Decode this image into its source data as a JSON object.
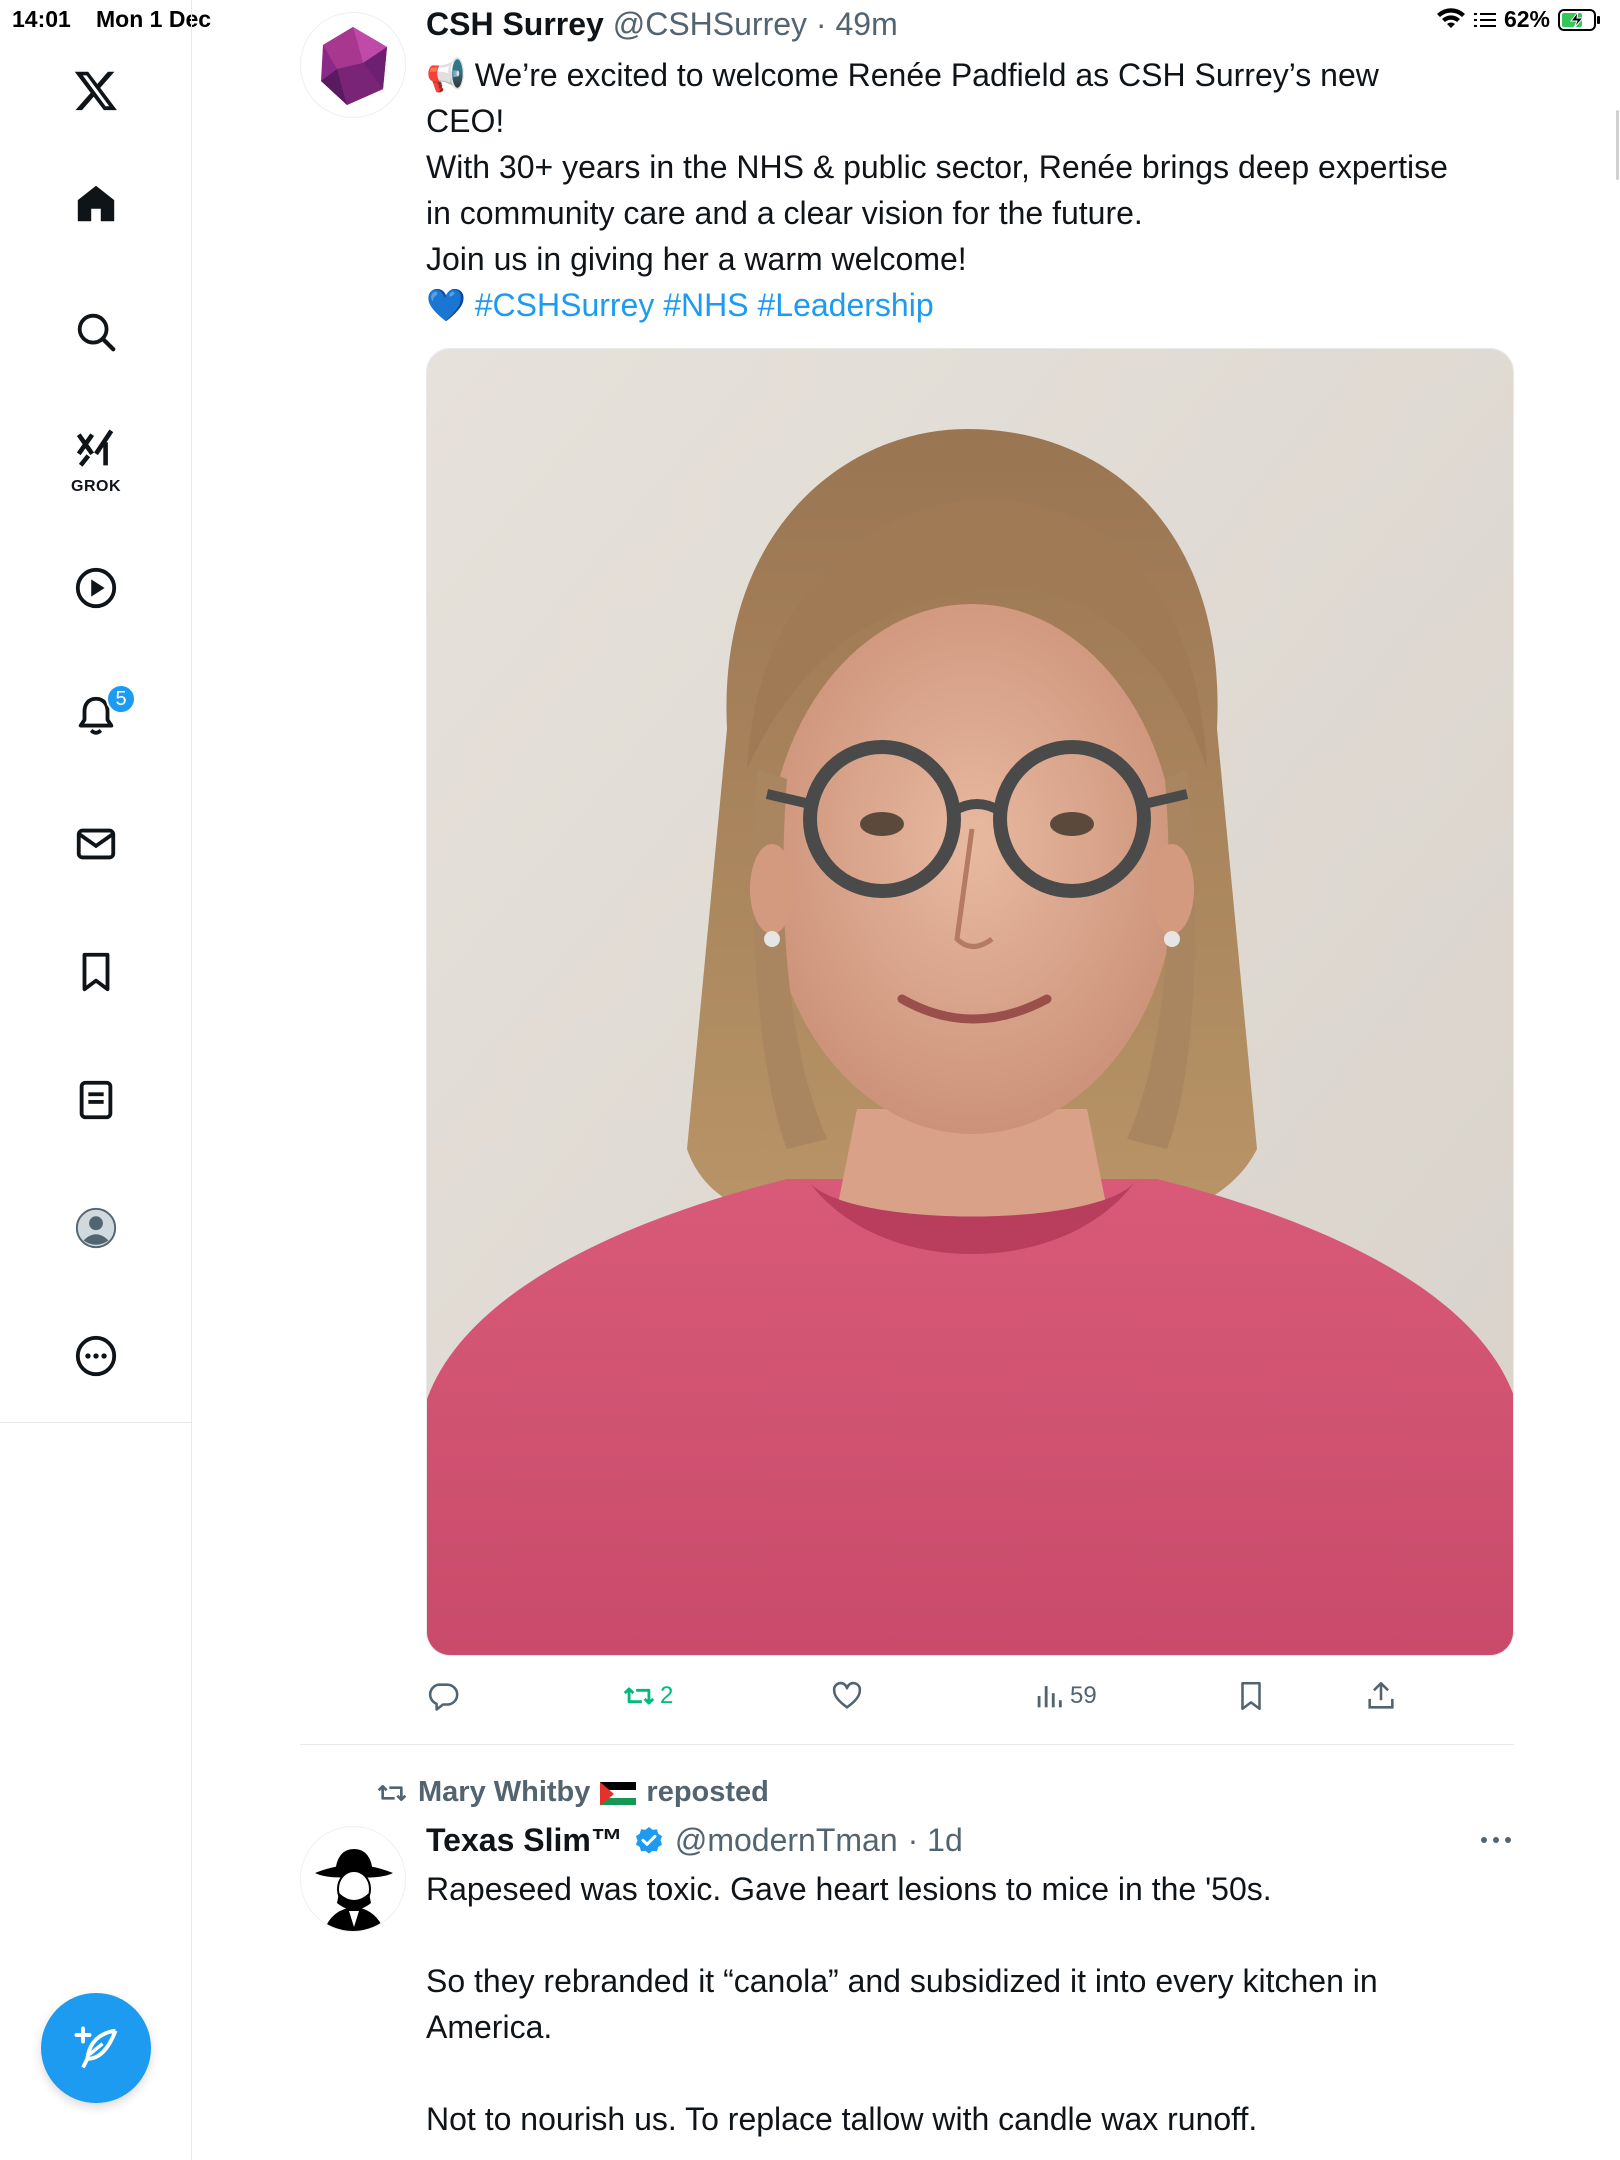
{
  "status_bar": {
    "time": "14:01",
    "date": "Mon 1 Dec",
    "battery": "62%"
  },
  "sidebar": {
    "items": [
      {
        "name": "x-logo-icon"
      },
      {
        "name": "home-icon"
      },
      {
        "name": "search-icon"
      },
      {
        "name": "grok-icon",
        "label": "GROK"
      },
      {
        "name": "video-icon"
      },
      {
        "name": "notifications-icon",
        "badge": "5"
      },
      {
        "name": "messages-icon"
      },
      {
        "name": "bookmarks-icon"
      },
      {
        "name": "lists-icon"
      },
      {
        "name": "profile-icon"
      },
      {
        "name": "more-icon"
      }
    ],
    "compose_icon": "compose-feather-icon",
    "accent_color": "#1d9bf0"
  },
  "tweet1": {
    "display_name": "CSH Surrey",
    "handle": "@CSHSurrey",
    "time": "· 49m",
    "lines": {
      "l1": "📢 We’re excited to welcome Renée Padfield as CSH Surrey’s new",
      "l2": "CEO!",
      "l3": "With 30+ years in the NHS & public sector, Renée brings deep expertise",
      "l4": "in community care and a clear vision for the future.",
      "l5": "Join us in giving her a warm welcome!",
      "l6_emoji": "💙",
      "hashtags": "#CSHSurrey #NHS #Leadership"
    },
    "actions": {
      "reply_count": "",
      "retweet_count": "2",
      "like_count": "",
      "views_count": "59"
    },
    "retweet_color": "#00ba7c"
  },
  "tweet2": {
    "reposted_by": "Mary Whitby",
    "reposted_label": "reposted",
    "display_name": "Texas Slim™",
    "handle": "@modernTman",
    "time": "· 1d",
    "paragraphs": {
      "p1": "Rapeseed was toxic. Gave heart lesions to mice in the '50s.",
      "p2a": "So they rebranded it “canola” and subsidized it into every kitchen in",
      "p2b": "America.",
      "p3": "Not to nourish us. To replace tallow with candle wax runoff."
    },
    "verified_color": "#1d9bf0"
  }
}
